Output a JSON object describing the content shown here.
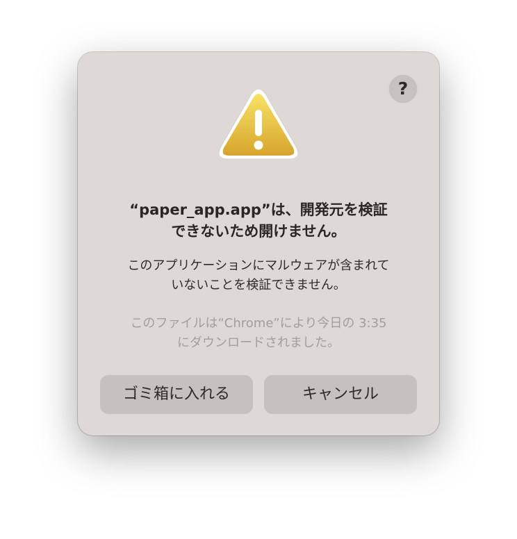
{
  "dialog": {
    "help_label": "?",
    "icon": "warning-triangle-icon",
    "title_line1": "“paper_app.app”は、開発元を検証",
    "title_line2": "できないため開けません。",
    "message_line1": "このアプリケーションにマルウェアが含まれて",
    "message_line2": "いないことを検証できません。",
    "source_line1": "このファイルは“Chrome”により今日の 3:35",
    "source_line2": "にダウンロードされました。",
    "move_to_trash_label": "ゴミ箱に入れる",
    "cancel_label": "キャンセル"
  },
  "colors": {
    "dialog_background": "#ded9d6",
    "button_background": "#c6c1be",
    "warning_yellow_top": "#f7de5c",
    "warning_yellow_bottom": "#d9a82f",
    "secondary_text": "#a29e9b"
  }
}
